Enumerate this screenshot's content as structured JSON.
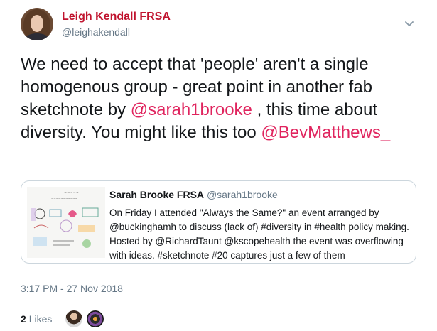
{
  "tweet": {
    "display_name": "Leigh Kendall FRSA",
    "handle": "@leighakendall",
    "text_1": "We need to accept that 'people' aren't a single homogenous group - great point in another fab sketchnote by ",
    "mention_1": "@sarah1brooke",
    "text_2": " , this time about diversity. You might like this too ",
    "mention_2": "@BevMatthews_",
    "timestamp": "3:17 PM - 27 Nov 2018"
  },
  "quote": {
    "name": "Sarah Brooke FRSA",
    "handle": "@sarah1brooke",
    "text": "On Friday I attended \"Always the Same?\" an event arranged by @buckinghamh to discuss (lack of) #diversity in #health policy making. Hosted by @RichardTaunt @kscopehealth the event was overflowing with ideas. #sketchnote #20 captures just a few of them"
  },
  "engagement": {
    "likes_count": "2",
    "likes_label": "Likes"
  },
  "icons": {
    "caret": "chevron-down-icon"
  },
  "colors": {
    "name": "#c0132e",
    "mention": "#e0245e",
    "secondary": "#657786"
  }
}
